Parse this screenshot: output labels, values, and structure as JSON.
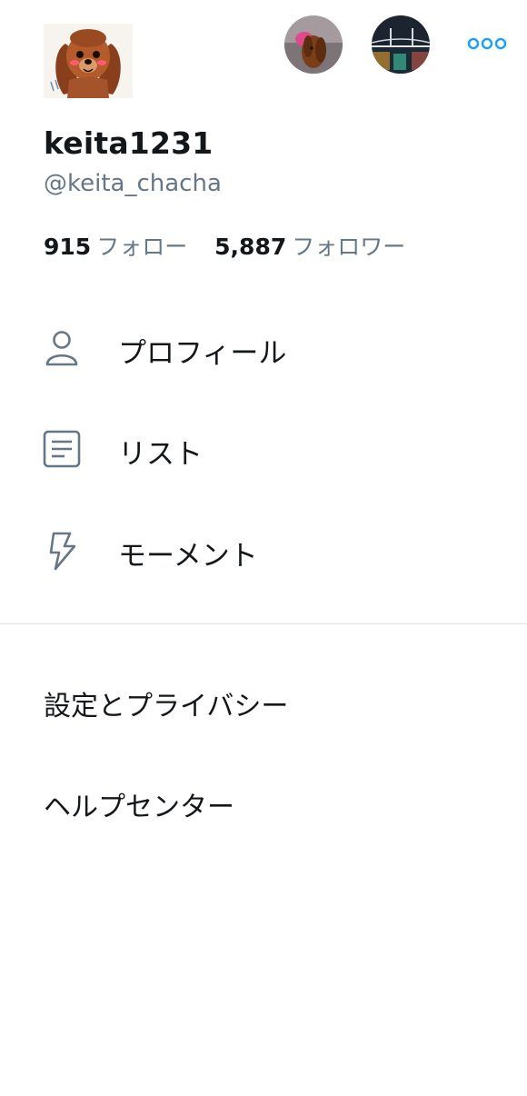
{
  "profile": {
    "display_name": "keita1231",
    "handle": "@keita_chacha",
    "following_count": "915",
    "following_label": "フォロー",
    "followers_count": "5,887",
    "followers_label": "フォロワー"
  },
  "accounts": {
    "icons": [
      "dog-avatar",
      "bridge-night-avatar"
    ],
    "more_icon": "more-dots-icon"
  },
  "menu": {
    "items": [
      {
        "label": "プロフィール",
        "icon": "person-icon"
      },
      {
        "label": "リスト",
        "icon": "list-icon"
      },
      {
        "label": "モーメント",
        "icon": "lightning-icon"
      }
    ]
  },
  "secondary": {
    "items": [
      {
        "label": "設定とプライバシー"
      },
      {
        "label": "ヘルプセンター"
      }
    ]
  },
  "colors": {
    "accent": "#1da1f2",
    "icon_gray": "#657786",
    "text": "#14171a",
    "divider": "#d9dee2"
  }
}
